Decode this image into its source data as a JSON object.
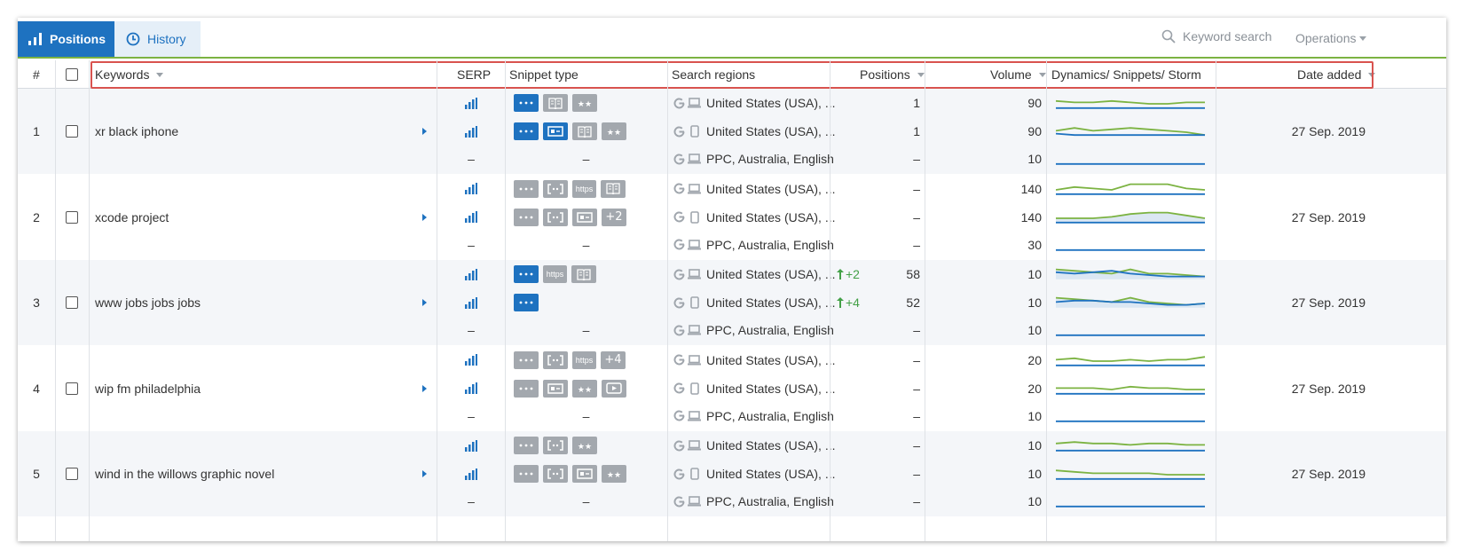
{
  "tabs": [
    {
      "label": "Positions",
      "icon": "bar-chart-icon"
    },
    {
      "label": "History",
      "icon": "clock-icon"
    }
  ],
  "search": {
    "placeholder": "Keyword search"
  },
  "operations_label": "Operations",
  "colors": {
    "accent": "#1e72c0",
    "highlight": "#d9534f",
    "green_line": "#7cb342",
    "blue_line": "#1e72c0"
  },
  "columns": {
    "index": "#",
    "keywords": "Keywords",
    "serp": "SERP",
    "snippet": "Snippet type",
    "regions": "Search regions",
    "positions": "Positions",
    "volume": "Volume",
    "dynamics": "Dynamics/ Snippets/ Storm",
    "date": "Date added"
  },
  "rows": [
    {
      "index": "1",
      "keyword": "xr black iphone",
      "date": "27 Sep. 2019",
      "sub": [
        {
          "serp": true,
          "snippets": [
            {
              "icon": "dots",
              "active": true
            },
            {
              "icon": "book",
              "active": false
            },
            {
              "icon": "stars",
              "active": false
            }
          ],
          "device": "desktop",
          "region": "United States (USA), ...",
          "change": "",
          "position": "1",
          "volume": "90",
          "green": [
            3,
            4,
            4,
            3,
            4,
            5,
            5,
            4,
            4
          ],
          "blue": [
            8,
            8,
            8,
            8,
            8,
            8,
            8,
            8,
            8
          ],
          "fill": false
        },
        {
          "serp": true,
          "snippets": [
            {
              "icon": "dots",
              "active": true
            },
            {
              "icon": "list",
              "active": true
            },
            {
              "icon": "book",
              "active": false
            },
            {
              "icon": "stars",
              "active": false
            }
          ],
          "device": "mobile",
          "region": "United States (USA), ...",
          "change": "",
          "position": "1",
          "volume": "90",
          "green": [
            4,
            2,
            4,
            3,
            2,
            3,
            4,
            5,
            7
          ],
          "blue": [
            6,
            7,
            7,
            7,
            7,
            7,
            7,
            7,
            7
          ],
          "fill": false
        },
        {
          "serp": false,
          "snippets": [],
          "device": "desktop",
          "region": "PPC, Australia, English",
          "change": "",
          "position": "–",
          "volume": "10",
          "green": [],
          "blue": [
            8,
            8,
            8,
            8,
            8,
            8,
            8,
            8,
            8
          ],
          "fill": false
        }
      ]
    },
    {
      "index": "2",
      "keyword": "xcode project",
      "date": "27 Sep. 2019",
      "sub": [
        {
          "serp": true,
          "snippets": [
            {
              "icon": "dots",
              "active": false
            },
            {
              "icon": "bracket",
              "active": false
            },
            {
              "icon": "https",
              "active": false
            },
            {
              "icon": "book",
              "active": false
            }
          ],
          "device": "desktop",
          "region": "United States (USA), ...",
          "change": "",
          "position": "–",
          "volume": "140",
          "green": [
            5,
            3,
            4,
            5,
            1,
            1,
            1,
            4,
            5
          ],
          "blue": [
            8,
            8,
            8,
            8,
            8,
            8,
            8,
            8,
            8
          ],
          "fill": false
        },
        {
          "serp": true,
          "snippets": [
            {
              "icon": "dots",
              "active": false
            },
            {
              "icon": "bracket",
              "active": false
            },
            {
              "icon": "list",
              "active": false
            },
            {
              "text": "+2",
              "active": false
            }
          ],
          "device": "mobile",
          "region": "United States (USA), ...",
          "change": "",
          "position": "–",
          "volume": "140",
          "green": [
            5,
            5,
            5,
            4,
            2,
            1,
            1,
            3,
            5
          ],
          "blue": [
            8,
            8,
            8,
            8,
            8,
            8,
            8,
            8,
            8
          ],
          "fill": true
        },
        {
          "serp": false,
          "snippets": [],
          "device": "desktop",
          "region": "PPC, Australia, English",
          "change": "",
          "position": "–",
          "volume": "30",
          "green": [],
          "blue": [
            8,
            8,
            8,
            8,
            8,
            8,
            8,
            8,
            8
          ],
          "fill": false
        }
      ]
    },
    {
      "index": "3",
      "keyword": "www jobs jobs jobs",
      "date": "27 Sep. 2019",
      "sub": [
        {
          "serp": true,
          "snippets": [
            {
              "icon": "dots",
              "active": true
            },
            {
              "icon": "https",
              "active": false
            },
            {
              "icon": "book",
              "active": false
            }
          ],
          "device": "desktop",
          "region": "United States (USA), ...",
          "change": "+2",
          "position": "58",
          "volume": "10",
          "green": [
            1,
            2,
            3,
            4,
            1,
            4,
            4,
            5,
            6
          ],
          "blue": [
            3,
            4,
            3,
            2,
            4,
            5,
            6,
            6,
            6
          ],
          "fill": true
        },
        {
          "serp": true,
          "snippets": [
            {
              "icon": "dots",
              "active": true
            }
          ],
          "device": "mobile",
          "region": "United States (USA), ...",
          "change": "+4",
          "position": "52",
          "volume": "10",
          "green": [
            1,
            2,
            3,
            4,
            1,
            4,
            5,
            6,
            5
          ],
          "blue": [
            4,
            3,
            3,
            4,
            4,
            5,
            6,
            6,
            5
          ],
          "fill": true
        },
        {
          "serp": false,
          "snippets": [],
          "device": "desktop",
          "region": "PPC, Australia, English",
          "change": "",
          "position": "–",
          "volume": "10",
          "green": [],
          "blue": [
            8,
            8,
            8,
            8,
            8,
            8,
            8,
            8,
            8
          ],
          "fill": false
        }
      ]
    },
    {
      "index": "4",
      "keyword": "wip fm philadelphia",
      "date": "27 Sep. 2019",
      "sub": [
        {
          "serp": true,
          "snippets": [
            {
              "icon": "dots",
              "active": false
            },
            {
              "icon": "bracket",
              "active": false
            },
            {
              "icon": "https",
              "active": false
            },
            {
              "text": "+4",
              "active": false
            }
          ],
          "device": "desktop",
          "region": "United States (USA), ...",
          "change": "",
          "position": "–",
          "volume": "20",
          "green": [
            4,
            3,
            5,
            5,
            4,
            5,
            4,
            4,
            2
          ],
          "blue": [
            8,
            8,
            8,
            8,
            8,
            8,
            8,
            8,
            8
          ],
          "fill": false
        },
        {
          "serp": true,
          "snippets": [
            {
              "icon": "dots",
              "active": false
            },
            {
              "icon": "list",
              "active": false
            },
            {
              "icon": "stars",
              "active": false
            },
            {
              "icon": "play",
              "active": false
            }
          ],
          "device": "mobile",
          "region": "United States (USA), ...",
          "change": "",
          "position": "–",
          "volume": "20",
          "green": [
            4,
            4,
            4,
            5,
            3,
            4,
            4,
            5,
            5
          ],
          "blue": [
            8,
            8,
            8,
            8,
            8,
            8,
            8,
            8,
            8
          ],
          "fill": false
        },
        {
          "serp": false,
          "snippets": [],
          "device": "desktop",
          "region": "PPC, Australia, English",
          "change": "",
          "position": "–",
          "volume": "10",
          "green": [],
          "blue": [
            8,
            8,
            8,
            8,
            8,
            8,
            8,
            8,
            8
          ],
          "fill": false
        }
      ]
    },
    {
      "index": "5",
      "keyword": "wind in the willows graphic novel",
      "date": "27 Sep. 2019",
      "sub": [
        {
          "serp": true,
          "snippets": [
            {
              "icon": "dots",
              "active": false
            },
            {
              "icon": "bracket",
              "active": false
            },
            {
              "icon": "stars",
              "active": false
            }
          ],
          "device": "desktop",
          "region": "United States (USA), ...",
          "change": "",
          "position": "–",
          "volume": "10",
          "green": [
            3,
            2,
            3,
            3,
            4,
            3,
            3,
            4,
            4
          ],
          "blue": [
            8,
            8,
            8,
            8,
            8,
            8,
            8,
            8,
            8
          ],
          "fill": false
        },
        {
          "serp": true,
          "snippets": [
            {
              "icon": "dots",
              "active": false
            },
            {
              "icon": "bracket",
              "active": false
            },
            {
              "icon": "list",
              "active": false
            },
            {
              "icon": "stars",
              "active": false
            }
          ],
          "device": "mobile",
          "region": "United States (USA), ...",
          "change": "",
          "position": "–",
          "volume": "10",
          "green": [
            2,
            3,
            4,
            4,
            4,
            4,
            5,
            5,
            5
          ],
          "blue": [
            8,
            8,
            8,
            8,
            8,
            8,
            8,
            8,
            8
          ],
          "fill": false
        },
        {
          "serp": false,
          "snippets": [],
          "device": "desktop",
          "region": "PPC, Australia, English",
          "change": "",
          "position": "–",
          "volume": "10",
          "green": [],
          "blue": [
            8,
            8,
            8,
            8,
            8,
            8,
            8,
            8,
            8
          ],
          "fill": false
        }
      ]
    }
  ]
}
